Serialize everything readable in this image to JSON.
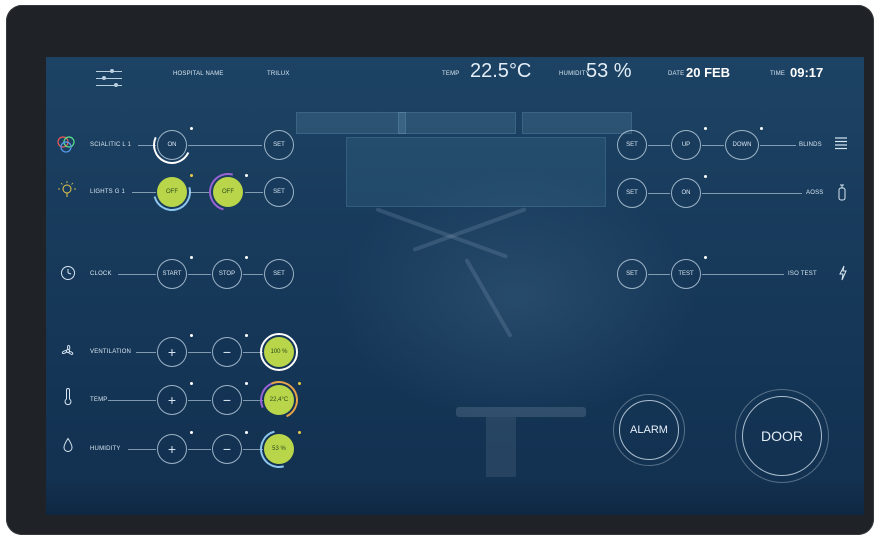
{
  "header": {
    "hospital_name": "HOSPITAL NAME",
    "brand": "TRILUX",
    "temp_label": "TEMP",
    "temp_value": "22.5",
    "temp_unit": "°C",
    "humidity_label": "HUMIDITY",
    "humidity_value": "53 %",
    "date_label": "DATE",
    "date_value": "20 FEB",
    "time_label": "TIME",
    "time_value": "09:17"
  },
  "left": {
    "scialitic": {
      "label": "SCIALITIC L 1",
      "on": "ON",
      "set": "SET"
    },
    "lights": {
      "label": "LIGHTS G 1",
      "off1": "OFF",
      "off2": "OFF",
      "set": "SET"
    },
    "clock": {
      "label": "CLOCK",
      "start": "START",
      "stop": "STOP",
      "set": "SET"
    },
    "ventilation": {
      "label": "VENTILATION",
      "plus": "+",
      "minus": "−",
      "value": "100 %"
    },
    "temp": {
      "label": "TEMP",
      "plus": "+",
      "minus": "−",
      "value": "22,4°C"
    },
    "humidity": {
      "label": "HUMIDITY",
      "plus": "+",
      "minus": "−",
      "value": "53 %"
    }
  },
  "right": {
    "blinds": {
      "label": "BLINDS",
      "set": "SET",
      "up": "UP",
      "down": "DOWN"
    },
    "aoss": {
      "label": "AOSS",
      "set": "SET",
      "on": "ON"
    },
    "iso": {
      "label": "ISO TEST",
      "set": "SET",
      "test": "TEST"
    }
  },
  "actions": {
    "alarm": "ALARM",
    "door": "DOOR"
  },
  "colors": {
    "accent_green": "#b9d64a",
    "accent_purple": "#9a63d6",
    "accent_orange": "#e8a24a",
    "accent_blue": "#8ec6ee",
    "screen_bg": "#17395a"
  },
  "icons": {
    "menu": "sliders-icon",
    "scialitic": "rgb-circles-icon",
    "lights": "bulb-icon",
    "clock": "clock-icon",
    "ventilation": "fan-icon",
    "temp": "thermometer-icon",
    "humidity": "droplet-icon",
    "blinds": "blinds-icon",
    "aoss": "oxygen-bottle-icon",
    "iso": "lightning-icon"
  }
}
